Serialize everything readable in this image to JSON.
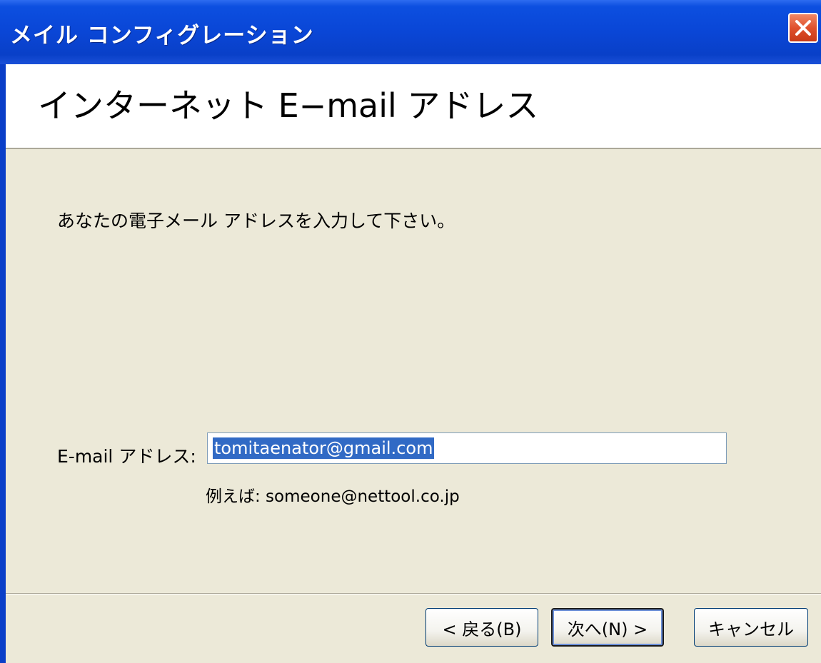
{
  "window": {
    "title": "メイル コンフィグレーション"
  },
  "header": {
    "title": "インターネット E−mail アドレス"
  },
  "main": {
    "instruction": "あなたの電子メール アドレスを入力して下さい。",
    "email_label": "E-mail アドレス:",
    "email_value": "tomitaenator@gmail.com",
    "example": "例えば: someone@nettool.co.jp"
  },
  "buttons": {
    "back": "< 戻る(B)",
    "next": "次へ(N) >",
    "cancel": "キャンセル"
  },
  "icons": {
    "close": "close-icon"
  },
  "colors": {
    "titlebar": "#0a46d6",
    "close_button": "#e0502c",
    "selection": "#316ac5",
    "dialog_bg": "#ece9d8"
  }
}
